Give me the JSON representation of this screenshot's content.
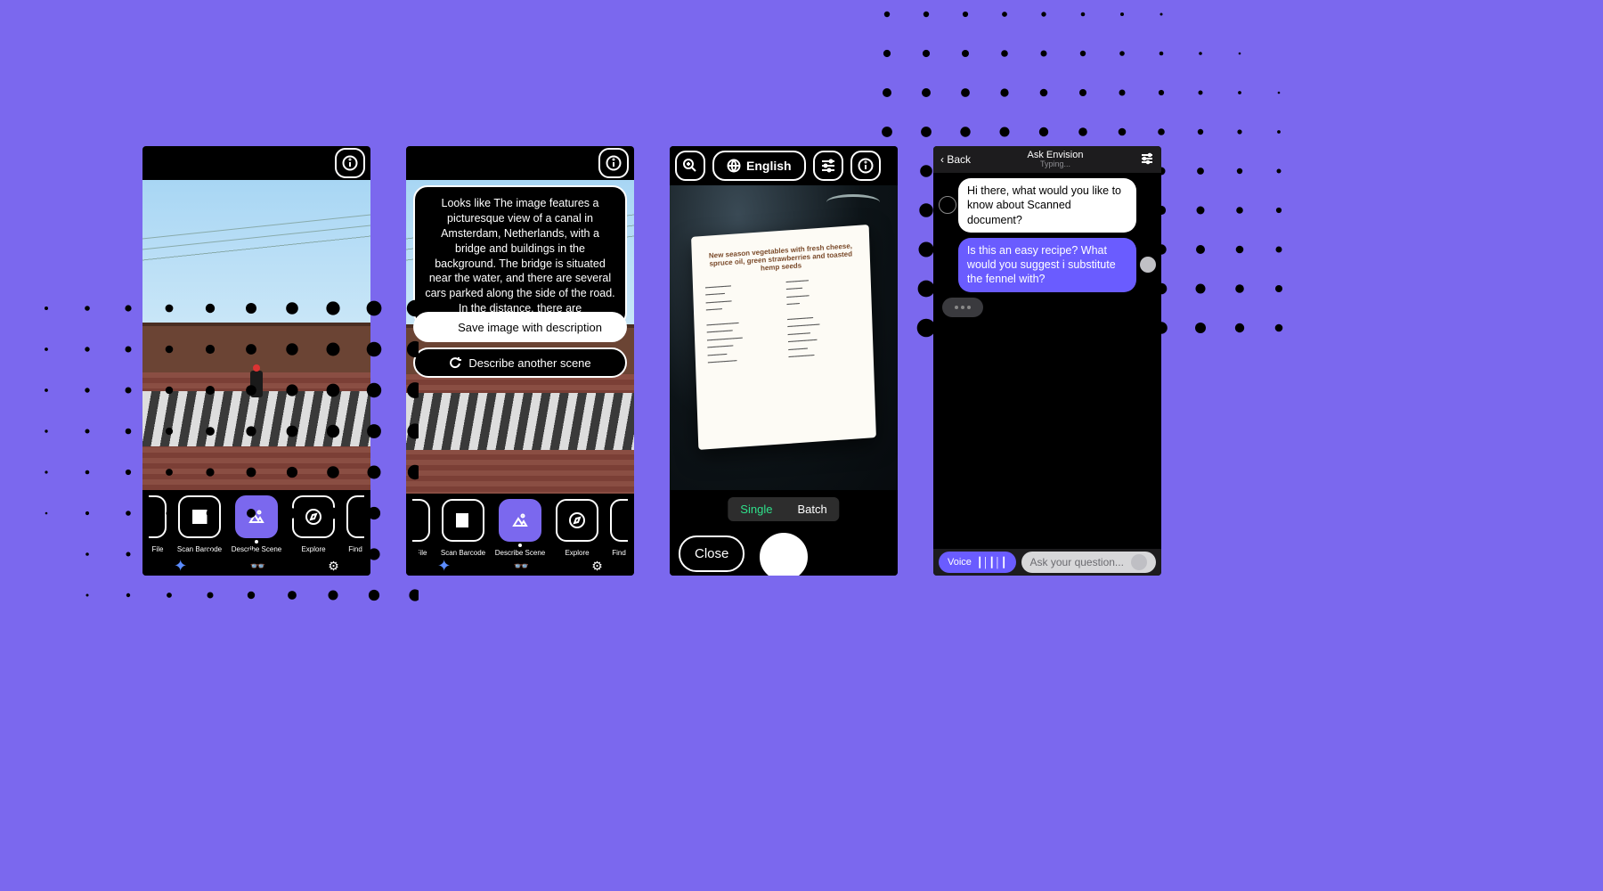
{
  "colors": {
    "accent": "#7b68ee",
    "chatAccent": "#6a5cff",
    "segOn": "#2fe08b"
  },
  "screen1": {
    "modes": [
      {
        "label": "File"
      },
      {
        "label": "Scan Barcode"
      },
      {
        "label": "Describe Scene",
        "selected": true
      },
      {
        "label": "Explore"
      },
      {
        "label": "Find"
      }
    ]
  },
  "screen2": {
    "description": "Looks like The image features a picturesque view of a canal in Amsterdam, Netherlands, with a bridge and buildings in the background. The bridge is situated near the water, and there are several cars parked along the side of the road. In the distance, there are",
    "saveBtn": "Save image with description",
    "anotherBtn": "Describe another scene",
    "modes": [
      {
        "label": "File"
      },
      {
        "label": "Scan Barcode"
      },
      {
        "label": "Describe Scene",
        "selected": true
      },
      {
        "label": "Explore"
      },
      {
        "label": "Find"
      }
    ]
  },
  "screen3": {
    "language": "English",
    "recipeTitle": "New season vegetables with fresh cheese, spruce oil, green strawberries and toasted hemp seeds",
    "segment": {
      "single": "Single",
      "batch": "Batch",
      "active": "single"
    },
    "close": "Close"
  },
  "screen4": {
    "back": "Back",
    "title": "Ask Envision",
    "subtitle": "Typing...",
    "botMsg": "Hi there, what would you like to know about Scanned document?",
    "userMsg": "Is this an easy recipe? What would you suggest i substitute the fennel with?",
    "voice": "Voice",
    "placeholder": "Ask your question..."
  }
}
